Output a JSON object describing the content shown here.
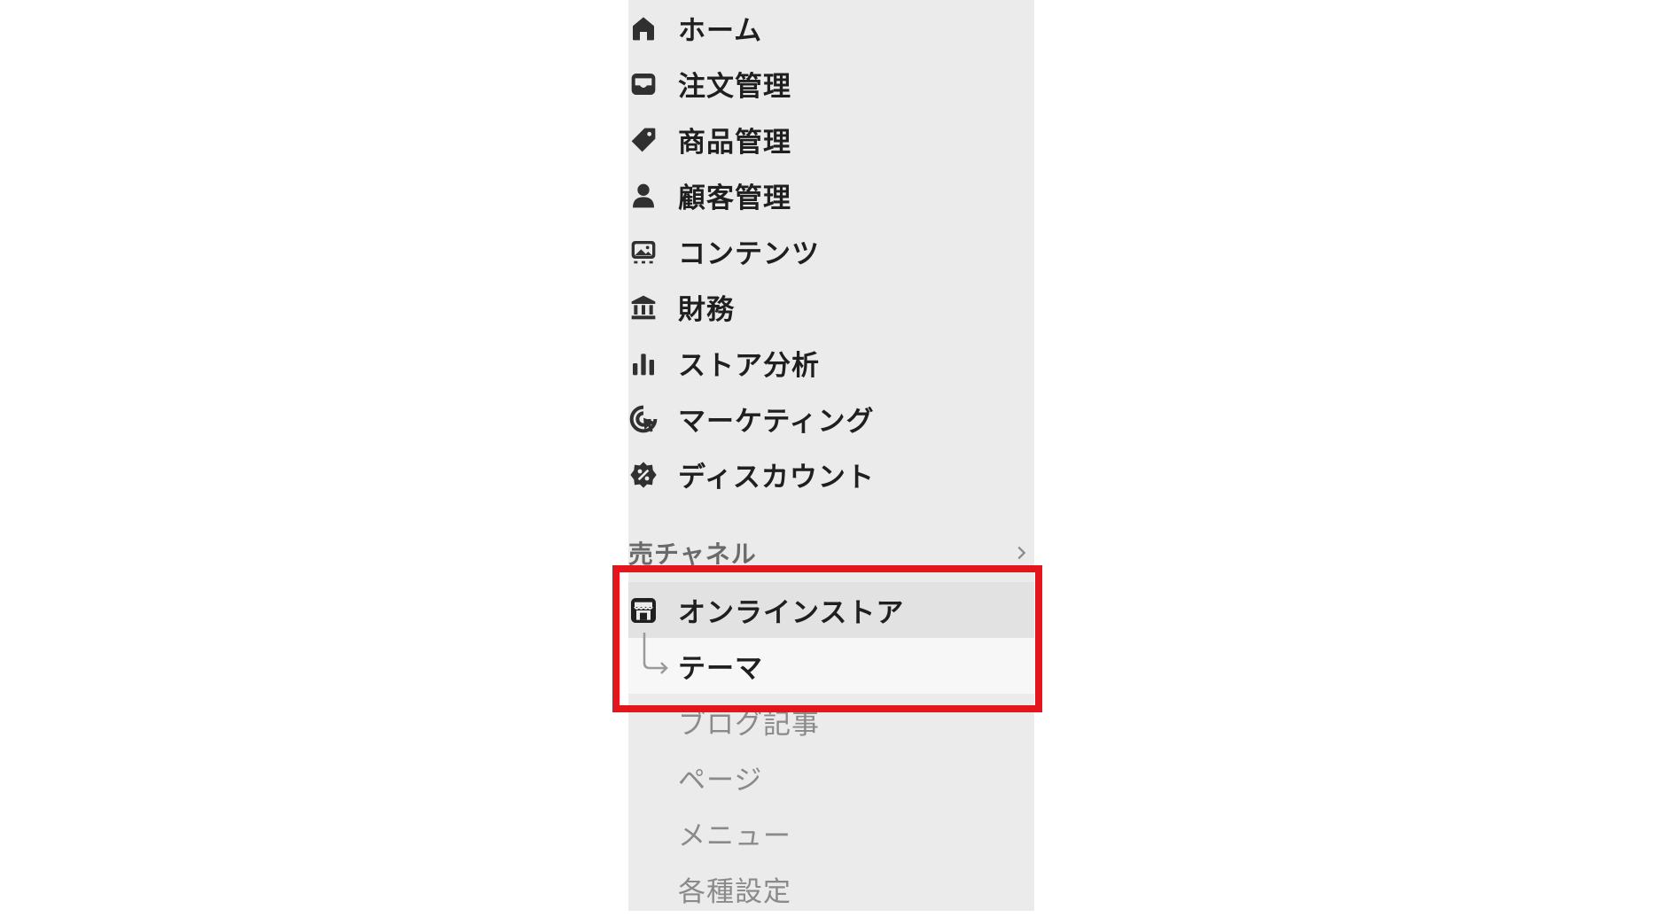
{
  "nav": {
    "items": [
      {
        "label": "ホーム",
        "icon": "home-icon"
      },
      {
        "label": "注文管理",
        "icon": "inbox-icon"
      },
      {
        "label": "商品管理",
        "icon": "tag-icon"
      },
      {
        "label": "顧客管理",
        "icon": "person-icon"
      },
      {
        "label": "コンテンツ",
        "icon": "image-icon"
      },
      {
        "label": "財務",
        "icon": "bank-icon"
      },
      {
        "label": "ストア分析",
        "icon": "bar-chart-icon"
      },
      {
        "label": "マーケティング",
        "icon": "target-cursor-icon"
      },
      {
        "label": "ディスカウント",
        "icon": "discount-badge-icon"
      }
    ]
  },
  "sales_channels": {
    "section_label": "売チャネル",
    "online_store": {
      "label": "オンラインストア",
      "icon": "storefront-icon"
    },
    "subitems": {
      "theme": "テーマ",
      "blog": "ブログ記事",
      "pages": "ページ",
      "menu": "メニュー",
      "settings": "各種設定"
    }
  },
  "colors": {
    "sidebar_bg": "#ebebeb",
    "highlight_border": "#e3161e",
    "active_sub_bg": "#f7f7f7"
  }
}
